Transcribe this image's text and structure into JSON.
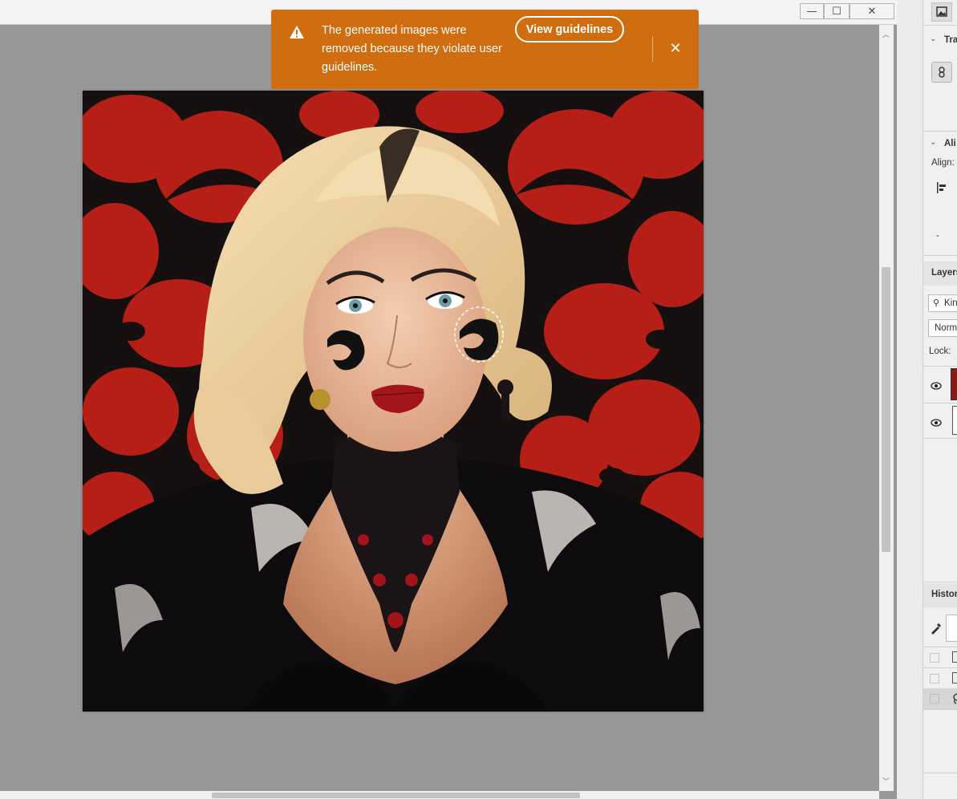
{
  "window": {
    "minimize_glyph": "—",
    "maximize_glyph": "☐",
    "close_glyph": "✕"
  },
  "toast": {
    "message": "The generated images were removed because they violate user guidelines.",
    "link_label": "View guidelines",
    "icon": "warning-triangle-icon",
    "close_glyph": "✕",
    "bg_color": "#d06d10"
  },
  "panels": {
    "properties_section": "Tra",
    "align_section": "Ali",
    "align_label": "Align:",
    "dash": "-",
    "layers_title": "Layers",
    "layers_search_value": "Kin",
    "blend_mode": "Norm",
    "lock_label": "Lock:",
    "history_title": "Histor"
  }
}
